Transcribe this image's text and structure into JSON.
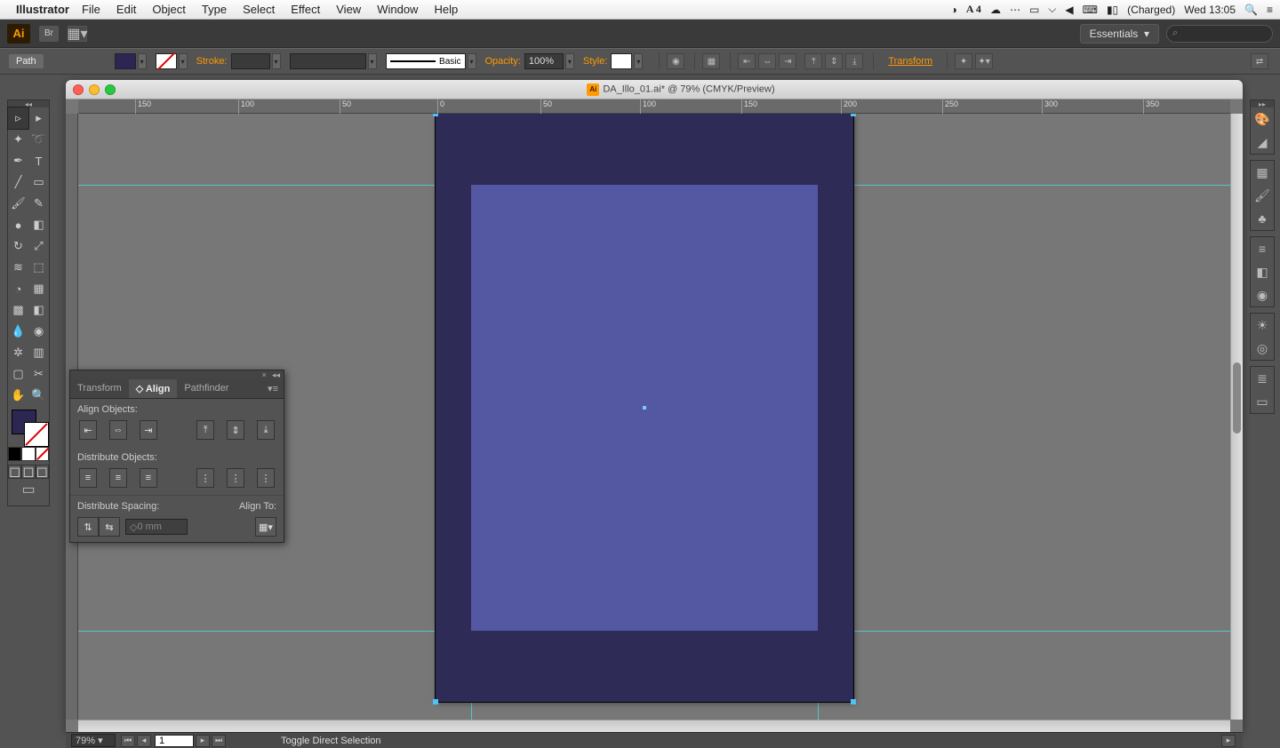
{
  "menubar": {
    "app": "Illustrator",
    "items": [
      "File",
      "Edit",
      "Object",
      "Type",
      "Select",
      "Effect",
      "View",
      "Window",
      "Help"
    ],
    "status": {
      "adobe_badge": "A   4",
      "battery": "(Charged)",
      "datetime": "Wed 13:05"
    }
  },
  "app_top": {
    "ai": "Ai",
    "br": "Br",
    "workspace": "Essentials",
    "search_placeholder": ""
  },
  "control_bar": {
    "object_label": "Path",
    "stroke_label": "Stroke:",
    "brush_label": "Basic",
    "opacity_label": "Opacity:",
    "opacity_value": "100%",
    "style_label": "Style:",
    "transform_label": "Transform"
  },
  "document": {
    "title": "DA_Illo_01.ai* @ 79% (CMYK/Preview)",
    "artboard_bg": "#2e2b57",
    "inner_fill": "#5458a3",
    "ruler_marks": [
      "150",
      "100",
      "50",
      "0",
      "50",
      "100",
      "150",
      "200",
      "250",
      "300",
      "350"
    ]
  },
  "align_panel": {
    "tabs": [
      "Transform",
      "Align",
      "Pathfinder"
    ],
    "active_tab": "Align",
    "sec_align": "Align Objects:",
    "sec_distribute": "Distribute Objects:",
    "sec_spacing": "Distribute Spacing:",
    "align_to": "Align To:",
    "spacing_value": "0 mm"
  },
  "status": {
    "zoom": "79%",
    "artboard_num": "1",
    "hint": "Toggle Direct Selection"
  },
  "tools": {
    "list": [
      "selection",
      "direct-selection",
      "magic-wand",
      "lasso",
      "pen",
      "type",
      "line",
      "rectangle",
      "paintbrush",
      "pencil",
      "blob-brush",
      "eraser",
      "rotate",
      "scale",
      "width",
      "free-transform",
      "shape-builder",
      "perspective",
      "mesh",
      "gradient",
      "eyedropper",
      "blend",
      "symbol-sprayer",
      "column-graph",
      "artboard",
      "slice",
      "hand",
      "zoom"
    ]
  },
  "right_dock": {
    "groups": [
      [
        "color",
        "color-guide"
      ],
      [
        "swatches",
        "brushes",
        "symbols"
      ],
      [
        "stroke",
        "gradient",
        "transparency"
      ],
      [
        "appearance",
        "graphic-styles"
      ],
      [
        "layers",
        "artboards"
      ]
    ]
  }
}
